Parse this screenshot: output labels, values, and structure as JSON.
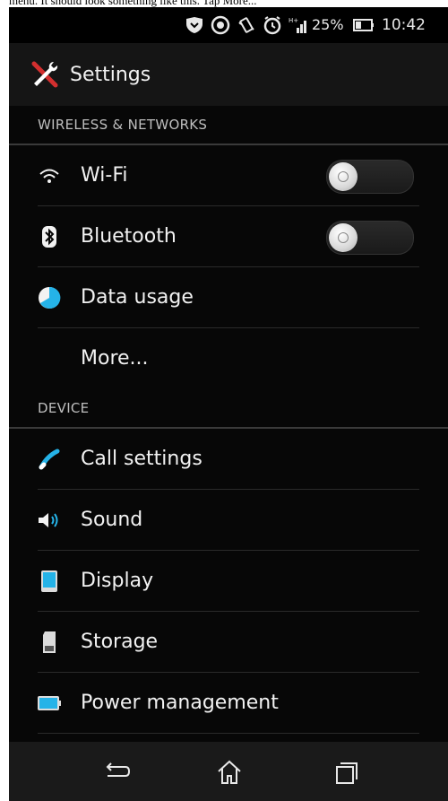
{
  "caption": "menu. It should look something like this. Tap More...",
  "status_bar": {
    "battery_percent": "25%",
    "time": "10:42",
    "icons": [
      "shield-icon",
      "sync-icon",
      "vibrate-icon",
      "alarm-icon",
      "signal-icon",
      "battery-icon"
    ]
  },
  "action_bar": {
    "title": "Settings",
    "icon": "settings-tools-icon"
  },
  "sections": [
    {
      "header": "WIRELESS & NETWORKS"
    },
    {
      "header": "DEVICE"
    }
  ],
  "items": {
    "wifi": {
      "label": "Wi-Fi",
      "icon": "wifi-icon",
      "toggle_on": false
    },
    "bluetooth": {
      "label": "Bluetooth",
      "icon": "bluetooth-icon",
      "toggle_on": false
    },
    "data_usage": {
      "label": "Data usage",
      "icon": "data-usage-icon"
    },
    "more": {
      "label": "More..."
    },
    "call_settings": {
      "label": "Call settings",
      "icon": "phone-icon"
    },
    "sound": {
      "label": "Sound",
      "icon": "speaker-icon"
    },
    "display": {
      "label": "Display",
      "icon": "display-icon"
    },
    "storage": {
      "label": "Storage",
      "icon": "storage-icon"
    },
    "power_management": {
      "label": "Power management",
      "icon": "battery-icon"
    }
  },
  "navigation": [
    "back-icon",
    "home-icon",
    "recent-apps-icon"
  ],
  "colors": {
    "background": "#070707",
    "text": "#f2f2f2",
    "accent_blue": "#25b3e8"
  }
}
